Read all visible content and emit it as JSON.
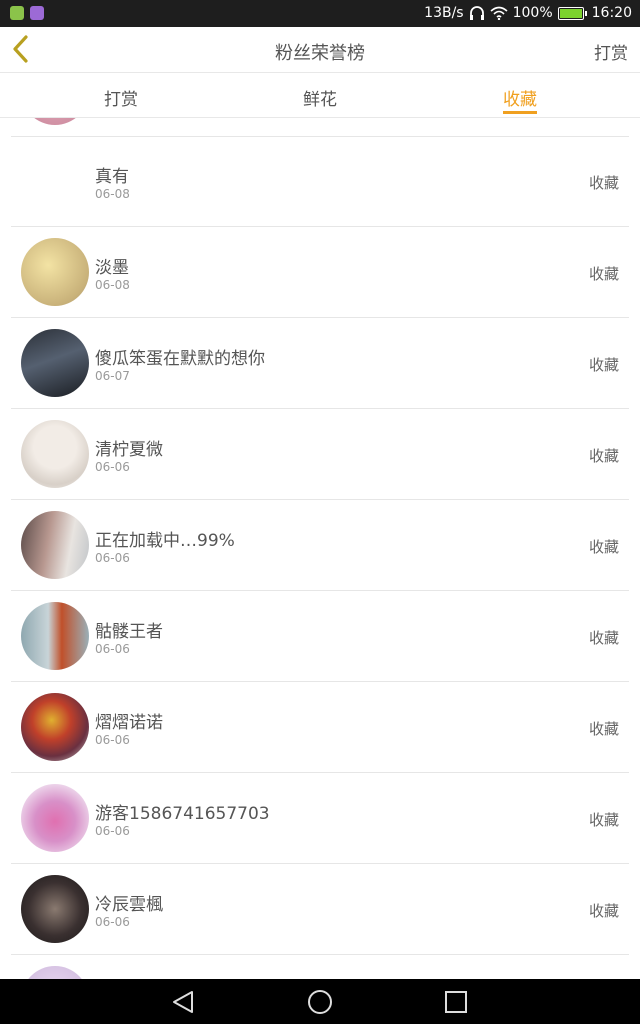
{
  "status_bar": {
    "speed": "13B/s",
    "battery": "100%",
    "time": "16:20",
    "icons": [
      "app-icon-green",
      "app-icon-purple",
      "headphones-icon",
      "wifi-icon",
      "battery-icon"
    ]
  },
  "header": {
    "title": "粉丝荣誉榜",
    "right_action": "打赏",
    "back_icon": "chevron-left-icon"
  },
  "tabs": [
    {
      "label": "打赏",
      "active": false
    },
    {
      "label": "鲜花",
      "active": false
    },
    {
      "label": "收藏",
      "active": true
    }
  ],
  "accent_color": "#f0a020",
  "list": [
    {
      "name": "真有",
      "date": "06-08",
      "action": "收藏",
      "avatar": "none"
    },
    {
      "name": "淡墨",
      "date": "06-08",
      "action": "收藏",
      "avatar": "beige-blur"
    },
    {
      "name": "傻瓜笨蛋在默默的想你",
      "date": "06-07",
      "action": "收藏",
      "avatar": "dark-portrait"
    },
    {
      "name": "清柠夏微",
      "date": "06-06",
      "action": "收藏",
      "avatar": "anime-girl"
    },
    {
      "name": "正在加载中…99%",
      "date": "06-06",
      "action": "收藏",
      "avatar": "couple-photo"
    },
    {
      "name": "骷髅王者",
      "date": "06-06",
      "action": "收藏",
      "avatar": "boy-red-jacket"
    },
    {
      "name": "熠熠诺诺",
      "date": "06-06",
      "action": "收藏",
      "avatar": "colorful-figure"
    },
    {
      "name": "游客1586741657703",
      "date": "06-06",
      "action": "收藏",
      "avatar": "pink-anime"
    },
    {
      "name": "冷辰雲楓",
      "date": "06-06",
      "action": "收藏",
      "avatar": "dark-anime"
    }
  ]
}
